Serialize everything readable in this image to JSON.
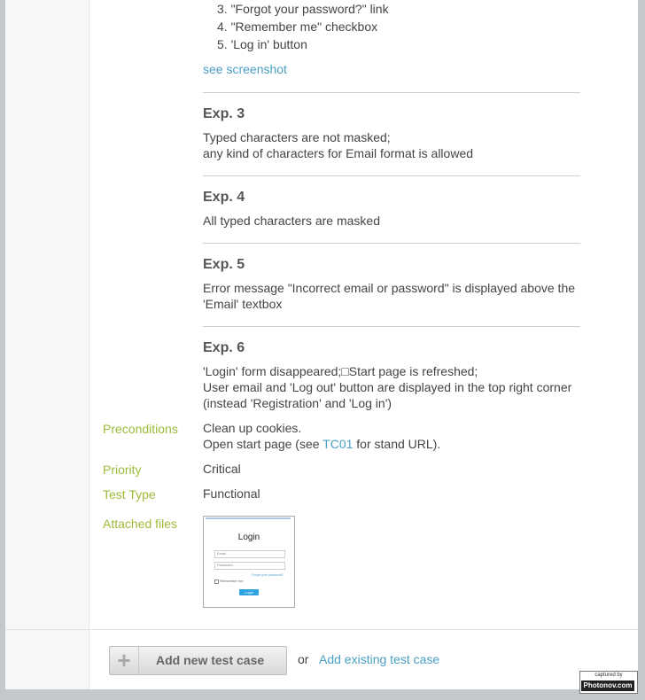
{
  "steps": [
    "3. \"Forgot your password?\" link",
    "4. \"Remember me\" checkbox",
    "5. 'Log in' button"
  ],
  "see_screenshot": "see screenshot",
  "expectations": [
    {
      "title": "Exp. 3",
      "lines": [
        "Typed characters are not masked;",
        "any kind of characters for Email format is allowed"
      ]
    },
    {
      "title": "Exp. 4",
      "lines": [
        "All typed characters are masked"
      ]
    },
    {
      "title": "Exp. 5",
      "lines": [
        "Error message \"Incorrect email or password\" is displayed above the",
        "'Email' textbox"
      ]
    },
    {
      "title": "Exp. 6",
      "lines": [
        "'Login' form disappeared;□Start page is refreshed;",
        "User email and 'Log out' button are displayed in the top right corner",
        "(instead 'Registration' and 'Log in')"
      ]
    }
  ],
  "fields": {
    "preconditions": {
      "label": "Preconditions",
      "line1": "Clean up cookies.",
      "line2_pre": "Open start page (see ",
      "line2_link": "TC01",
      "line2_post": " for stand URL)."
    },
    "priority": {
      "label": "Priority",
      "value": "Critical"
    },
    "test_type": {
      "label": "Test Type",
      "value": "Functional"
    },
    "attached": {
      "label": "Attached files"
    }
  },
  "thumbnail": {
    "title": "Login",
    "email_placeholder": "Email",
    "password_placeholder": "Password",
    "forgot": "Forgot your password?",
    "remember": "Remember me",
    "button": "Login"
  },
  "footer": {
    "add_new": "Add new test case",
    "or": "or",
    "add_existing": "Add existing test case"
  },
  "watermark": {
    "top": "captured by",
    "bottom": "Photonov.com"
  }
}
